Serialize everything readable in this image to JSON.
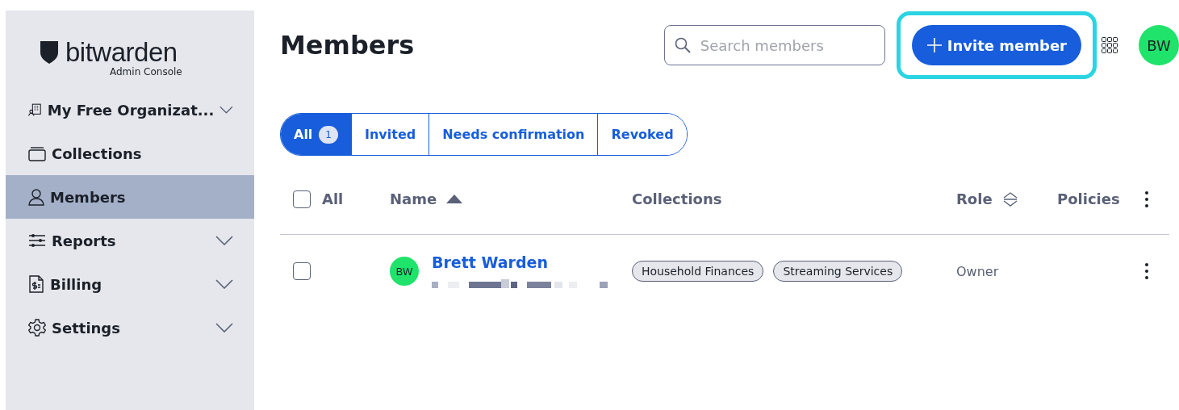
{
  "sidebar": {
    "logo": "**bit**warden",
    "subtitle": "Admin Console",
    "items": [
      {
        "kind": "org",
        "label": "My Free Organizat...",
        "selected": false,
        "expandable": true
      },
      {
        "kind": "collections",
        "label": "Collections",
        "selected": false,
        "expandable": false
      },
      {
        "kind": "members",
        "label": "Members",
        "selected": true,
        "expandable": false
      },
      {
        "kind": "reports",
        "label": "Reports",
        "selected": false,
        "expandable": true
      },
      {
        "kind": "billing",
        "label": "Billing",
        "selected": false,
        "expandable": true
      },
      {
        "kind": "settings",
        "label": "Settings",
        "selected": false,
        "expandable": true
      }
    ]
  },
  "header": {
    "title": "Members",
    "search": {
      "placeholder": "Search members"
    },
    "invite_button": {
      "label": "Invite member",
      "highlighted": true
    },
    "avatar": {
      "initials": "BW",
      "color": "#1fe36a"
    }
  },
  "filters": [
    {
      "label": "All",
      "count": "1",
      "selected": true
    },
    {
      "label": "Invited",
      "selected": false
    },
    {
      "label": "Needs confirmation",
      "selected": false
    },
    {
      "label": "Revoked",
      "selected": false
    }
  ],
  "table": {
    "select_all": {
      "label": "All",
      "checked": false
    },
    "columns": [
      {
        "label": "Name",
        "kind": "sorted"
      },
      {
        "label": "Collections",
        "kind": "plain"
      },
      {
        "label": "Role",
        "kind": "sortable"
      },
      {
        "label": "Policies",
        "kind": "plain"
      }
    ],
    "rows": [
      {
        "initials": "BW",
        "color": "#1fe36a",
        "name": "Brett Warden",
        "checked": false,
        "collections": [
          "Household Finances",
          "Streaming Services"
        ],
        "role": "Owner"
      }
    ]
  }
}
